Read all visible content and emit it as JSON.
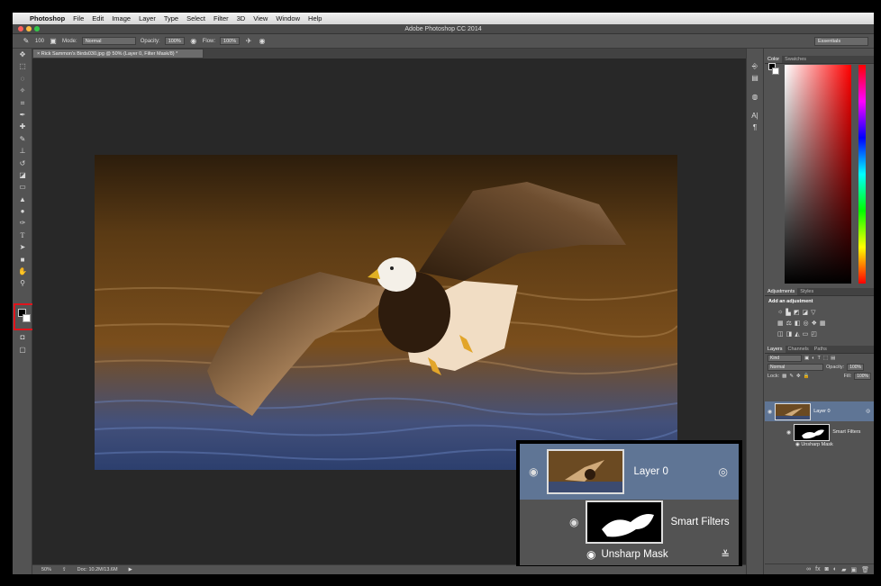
{
  "menubar": {
    "apple": "",
    "app": "Photoshop",
    "items": [
      "File",
      "Edit",
      "Image",
      "Layer",
      "Type",
      "Select",
      "Filter",
      "3D",
      "View",
      "Window",
      "Help"
    ]
  },
  "window": {
    "title": "Adobe Photoshop CC 2014"
  },
  "options": {
    "brush_size": "100",
    "mode_label": "Mode:",
    "mode_value": "Normal",
    "opacity_label": "Opacity:",
    "opacity_value": "100%",
    "flow_label": "Flow:",
    "flow_value": "100%",
    "workspace": "Essentials"
  },
  "document": {
    "tab_title": "Rick Sammon's Birds030.jpg @ 50% (Layer 0, Filter Mask/8) *"
  },
  "status": {
    "zoom": "50%",
    "doc": "Doc: 10.2M/13.6M"
  },
  "color_panel": {
    "tabs": [
      "Color",
      "Swatches"
    ]
  },
  "adjustments_panel": {
    "tabs": [
      "Adjustments",
      "Styles"
    ],
    "title": "Add an adjustment"
  },
  "layers_panel": {
    "tabs": [
      "Layers",
      "Channels",
      "Paths"
    ],
    "kind": "Kind",
    "blend": "Normal",
    "opacity_label": "Opacity:",
    "opacity_value": "100%",
    "lock_label": "Lock:",
    "fill_label": "Fill:",
    "fill_value": "100%",
    "layer_name": "Layer 0",
    "smart_filters": "Smart Filters",
    "filter_name": "Unsharp Mask"
  },
  "zoom_callout": {
    "layer_name": "Layer 0",
    "smart_filters": "Smart Filters",
    "filter_name": "Unsharp Mask"
  },
  "colors": {
    "accent_selection": "#5f7595",
    "highlight_box": "#e0141c"
  }
}
